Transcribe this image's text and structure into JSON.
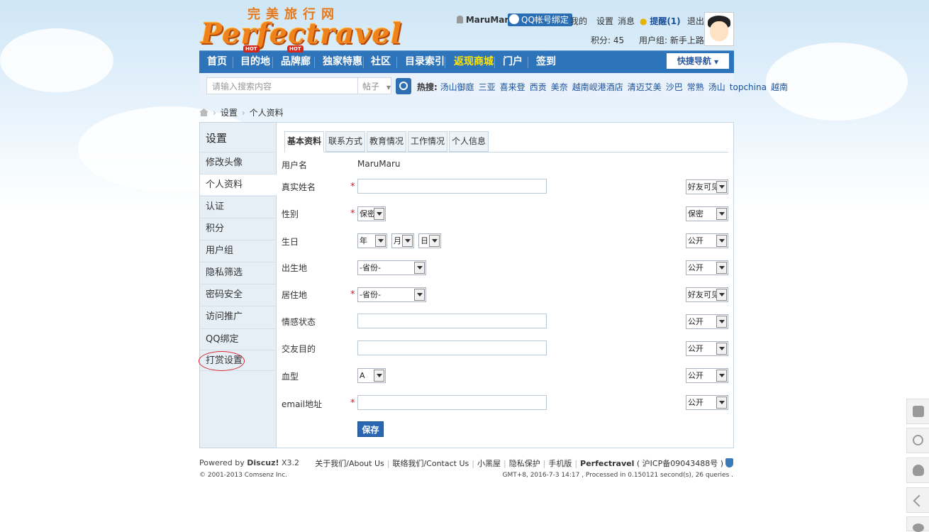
{
  "header": {
    "site_name_cn": "完美旅行网",
    "logo_text": "Perfectravel",
    "username": "MaruMaru",
    "qq_bind": "QQ帐号绑定",
    "my": "我的",
    "settings": "设置",
    "messages": "消息",
    "remind": "提醒(1)",
    "logout": "退出",
    "points": "积分: 45",
    "usergroup": "用户组: 新手上路"
  },
  "nav": {
    "items": [
      "首页",
      "目的地",
      "品牌廊",
      "独家特惠",
      "社区",
      "目录索引",
      "返现商城",
      "门户",
      "签到"
    ],
    "hot_badge": "HOT",
    "quick_nav": "快捷导航"
  },
  "search": {
    "placeholder": "请输入搜索内容",
    "type": "帖子",
    "hot_label": "热搜:",
    "hot_words": [
      "汤山御庭",
      "三亚",
      "喜来登",
      "西贡",
      "美奈",
      "越南岘港酒店",
      "清迈艾美",
      "沙巴",
      "常熟",
      "汤山",
      "topchina",
      "越南"
    ]
  },
  "breadcrumb": {
    "items": [
      "设置",
      "个人资料"
    ]
  },
  "sidebar": {
    "title": "设置",
    "items": [
      "修改头像",
      "个人资料",
      "认证",
      "积分",
      "用户组",
      "隐私筛选",
      "密码安全",
      "访问推广",
      "QQ绑定",
      "打赏设置"
    ]
  },
  "tabs": [
    "基本资料",
    "联系方式",
    "教育情况",
    "工作情况",
    "个人信息"
  ],
  "form": {
    "username_label": "用户名",
    "username_value": "MaruMaru",
    "required_mark": "*",
    "realname_label": "真实姓名",
    "gender_label": "性别",
    "gender_value": "保密",
    "birthday_label": "生日",
    "year": "年",
    "month": "月",
    "day": "日",
    "birthplace_label": "出生地",
    "province": "-省份-",
    "residence_label": "居住地",
    "relationship_label": "情感状态",
    "purpose_label": "交友目的",
    "blood_label": "血型",
    "blood_value": "A",
    "email_label": "email地址",
    "privacy": [
      "好友可见",
      "保密",
      "公开",
      "公开",
      "好友可见",
      "公开",
      "公开",
      "公开",
      "公开"
    ],
    "save": "保存"
  },
  "footer": {
    "powered_prefix": "Powered by ",
    "powered_name": "Discuz!",
    "version": " X3.2",
    "copyright": "© 2001-2013 Comsenz Inc.",
    "links": [
      "关于我们/About Us",
      "联络我们/Contact Us",
      "小黑屋",
      "隐私保护",
      "手机版"
    ],
    "site": "Perfectravel",
    "icp": "( 沪ICP备09043488号 )",
    "time": "GMT+8, 2016-7-3 14:17 , Processed in 0.150121 second(s), 26 queries ."
  },
  "colors": {
    "nav_blue": "#2e74bb",
    "required_red": "#e4161e",
    "logo_orange": "#f0821e"
  }
}
